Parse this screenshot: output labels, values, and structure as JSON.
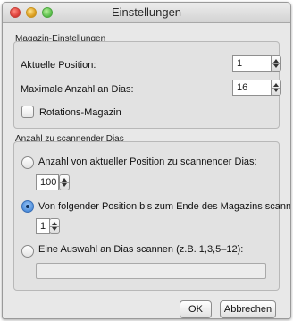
{
  "window": {
    "title": "Einstellungen"
  },
  "magazine": {
    "group_title": "Magazin-Einstellungen",
    "current_position_label": "Aktuelle Position:",
    "current_position_value": "1",
    "max_slides_label": "Maximale Anzahl an Dias:",
    "max_slides_value": "16",
    "rotation_label": "Rotations-Magazin",
    "rotation_checked": false
  },
  "scan": {
    "group_title": "Anzahl zu scannender Dias",
    "option1_label": "Anzahl von aktueller Position zu scannender Dias:",
    "option1_value": "100",
    "option2_label": "Von folgender Position bis zum Ende des Magazins scannen:",
    "option2_value": "1",
    "option3_label": "Eine Auswahl an Dias scannen (z.B. 1,3,5–12):",
    "option3_value": "",
    "selected_option": 2
  },
  "buttons": {
    "ok": "OK",
    "cancel": "Abbrechen"
  }
}
